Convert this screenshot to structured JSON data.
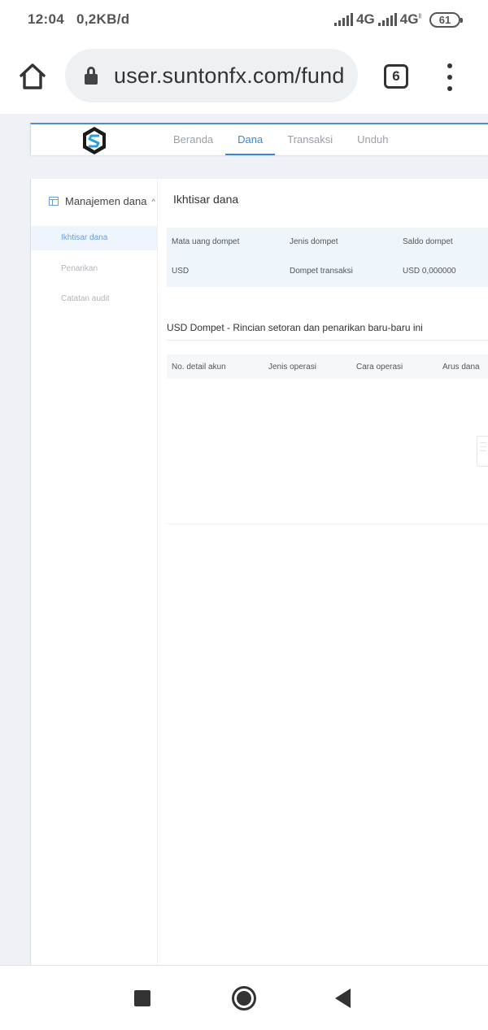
{
  "status_bar": {
    "time": "12:04",
    "speed": "0,2KB/d",
    "network_1": "4G",
    "network_2": "4G",
    "network_2_sup": "ll",
    "battery": "61"
  },
  "browser": {
    "url": "user.suntonfx.com/fund",
    "tab_count": "6"
  },
  "site": {
    "nav": [
      "Beranda",
      "Dana",
      "Transaksi",
      "Unduh"
    ],
    "active_nav": "Dana",
    "brand_color": "#3b86d4"
  },
  "sidebar": {
    "section": "Manajemen dana",
    "items": [
      "Ikhtisar dana",
      "Penarikan",
      "Catatan audit"
    ]
  },
  "overview": {
    "title": "Ikhtisar dana",
    "columns": [
      "Mata uang dompet",
      "Jenis dompet",
      "Saldo dompet"
    ],
    "row": [
      "USD",
      "Dompet transaksi",
      "USD 0,000000"
    ]
  },
  "details": {
    "title": "USD Dompet - Rincian setoran dan penarikan baru-baru ini",
    "columns": [
      "No. detail akun",
      "Jenis operasi",
      "Cara operasi",
      "Arus dana"
    ]
  },
  "icons": {
    "home": "home-icon",
    "lock": "lock-icon",
    "menu": "more-vert-icon",
    "recents": "square-icon",
    "home_nav": "circle-icon",
    "back": "back-triangle-icon"
  }
}
